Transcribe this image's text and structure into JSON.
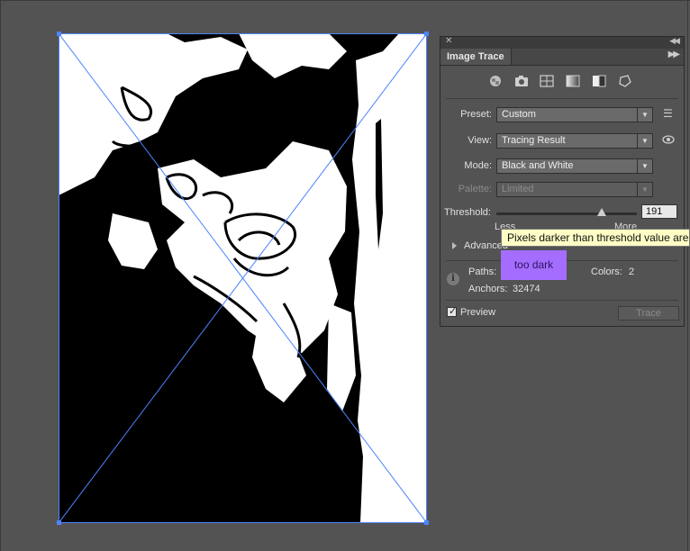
{
  "colors": {
    "canvas_bg": "#535353",
    "selection_blue": "#4f83ff",
    "tooltip_bg": "#fdfdc5",
    "note_bg": "#a56dff"
  },
  "panel": {
    "title": "Image Trace",
    "close_icon": "close-icon",
    "collapse_icon": "double-chevron-left-icon",
    "menu_icon": "double-chevron-right-icon",
    "preset_icons": [
      "auto-color-icon",
      "high-color-icon",
      "low-color-icon",
      "grayscale-icon",
      "black-and-white-icon",
      "outline-icon"
    ],
    "preset": {
      "label": "Preset:",
      "value": "Custom"
    },
    "view": {
      "label": "View:",
      "value": "Tracing Result"
    },
    "mode": {
      "label": "Mode:",
      "value": "Black and White"
    },
    "palette": {
      "label": "Palette:",
      "value": "Limited",
      "disabled": true
    },
    "threshold": {
      "label": "Threshold:",
      "value": "191",
      "min_label": "Less",
      "max_label": "More",
      "level": 191,
      "max": 255
    },
    "advanced": {
      "label": "Advanced"
    },
    "stats": {
      "paths_label": "Paths:",
      "colors_label": "Colors:",
      "colors_value": "2",
      "anchors_label": "Anchors:",
      "anchors_value": "32474"
    },
    "preview": {
      "label": "Preview",
      "checked": true
    },
    "trace_button": "Trace"
  },
  "tooltip": "Pixels darker than threshold value are",
  "annotation": "too dark"
}
